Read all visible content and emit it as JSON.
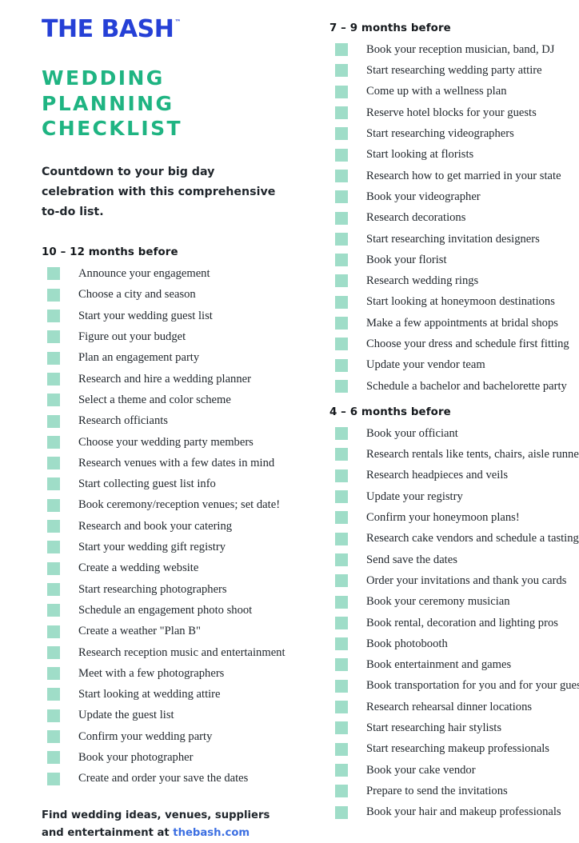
{
  "brand": {
    "name": "THE BASH",
    "trademark": "™",
    "color": "#2540d6"
  },
  "title": "WEDDING PLANNING CHECKLIST",
  "title_color": "#1fb482",
  "subtitle": "Countdown to your big day celebration with this comprehensive to-do list.",
  "checkbox_color": "#9fddc8",
  "left_column": {
    "section": {
      "heading": "10 – 12 months before",
      "items": [
        "Announce your engagement",
        "Choose a city and season",
        "Start your wedding guest list",
        "Figure out your budget",
        "Plan an engagement party",
        "Research and hire a wedding planner",
        "Select a theme and color scheme",
        "Research officiants",
        "Choose your wedding party members",
        "Research venues with a few dates in mind",
        "Start collecting guest list info",
        "Book ceremony/reception venues; set date!",
        "Research and book your catering",
        "Start your wedding gift registry",
        "Create a wedding website",
        "Start researching photographers",
        "Schedule an engagement photo shoot",
        "Create a weather \"Plan B\"",
        "Research reception music and entertainment",
        "Meet with a few photographers",
        "Start looking at wedding attire",
        "Update the guest list",
        "Confirm your wedding party",
        "Book your photographer",
        "Create and order your save the dates"
      ]
    }
  },
  "right_column": {
    "sections": [
      {
        "heading": "7 – 9 months before",
        "items": [
          "Book your reception musician, band, DJ",
          "Start researching wedding party attire",
          "Come up with a wellness plan",
          "Reserve hotel blocks for your guests",
          "Start researching videographers",
          "Start looking at florists",
          "Research how to get married in your state",
          "Book your videographer",
          "Research decorations",
          "Start researching invitation designers",
          "Book your florist",
          "Research wedding rings",
          "Start looking at honeymoon destinations",
          "Make a few appointments at bridal shops",
          "Choose your dress and schedule first fitting",
          "Update your vendor team",
          "Schedule a bachelor and bachelorette party"
        ]
      },
      {
        "heading": "4 – 6 months before",
        "items": [
          "Book your officiant",
          "Research rentals like tents, chairs, aisle runner",
          "Research headpieces and veils",
          "Update your registry",
          "Confirm your honeymoon plans!",
          "Research cake vendors and schedule a tasting",
          "Send save the dates",
          "Order your invitations and thank you cards",
          "Book your ceremony musician",
          "Book rental, decoration and lighting pros",
          "Book photobooth",
          "Book entertainment and games",
          "Book transportation for you and for your guests",
          "Research rehearsal dinner locations",
          "Start researching hair stylists",
          "Start researching makeup professionals",
          "Book your cake vendor",
          "Prepare to send the invitations",
          "Book your hair and makeup professionals"
        ]
      }
    ]
  },
  "footer": {
    "text_before": "Find wedding ideas, venues, suppliers and entertainment at ",
    "link_text": "thebash.com",
    "link_color": "#3c6fe2"
  }
}
